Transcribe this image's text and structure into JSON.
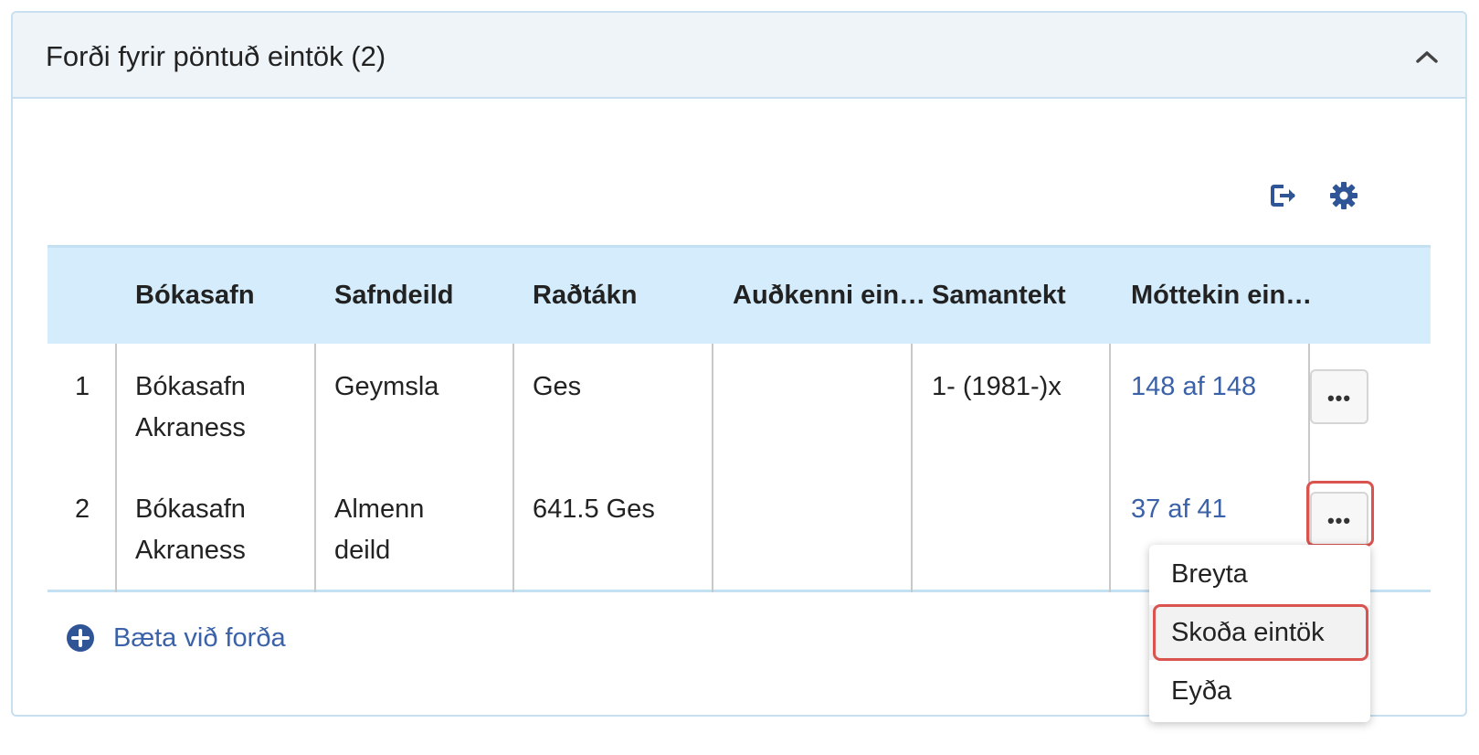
{
  "panel": {
    "title": "Forði fyrir pöntuð eintök (2)",
    "collapse_icon": "chevron-up-icon"
  },
  "toolbar": {
    "export_icon": "export-icon",
    "settings_icon": "gear-icon"
  },
  "table": {
    "columns": [
      "",
      "Bókasafn",
      "Safndeild",
      "Raðtákn",
      "Auðkenni ein…",
      "Samantekt",
      "Móttekin ein…"
    ],
    "rows": [
      {
        "index": "1",
        "library_line1": "Bókasafn",
        "library_line2": "Akraness",
        "department_line1": "Geymsla",
        "department_line2": "",
        "call_number": "Ges",
        "item_id": "",
        "summary": "1- (1981-)x",
        "received": "148 af 148"
      },
      {
        "index": "2",
        "library_line1": "Bókasafn",
        "library_line2": "Akraness",
        "department_line1": "Almenn",
        "department_line2": "deild",
        "call_number": "641.5 Ges",
        "item_id": "",
        "summary": "",
        "received": "37 af 41"
      }
    ],
    "more_label": "•••"
  },
  "add_holding": {
    "label": "Bæta við forða",
    "icon": "plus-circle-icon"
  },
  "context_menu": {
    "items": [
      "Breyta",
      "Skoða eintök",
      "Eyða"
    ],
    "active_index": 1
  },
  "colors": {
    "link": "#3b62a8",
    "header_bg": "#d4ecfb",
    "highlight": "#d9534f"
  }
}
